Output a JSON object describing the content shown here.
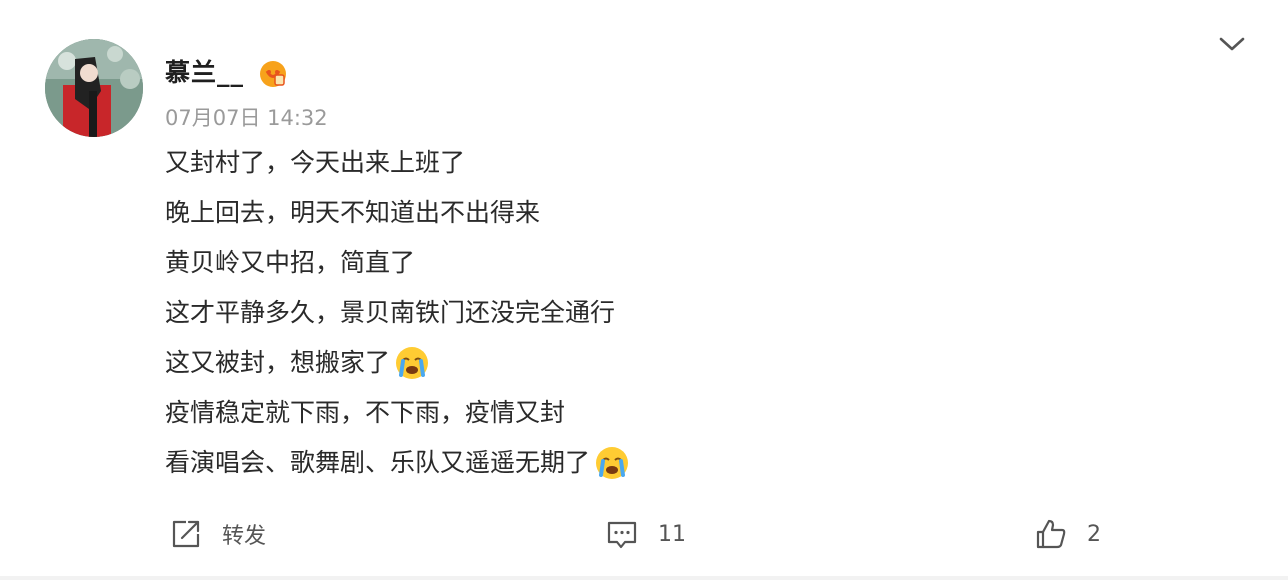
{
  "post": {
    "username": "慕兰__",
    "timestamp": "07月07日 14:32",
    "lines": [
      "又封村了，今天出来上班了",
      "晚上回去，明天不知道出不出得来",
      "黄贝岭又中招，简直了",
      "这才平静多久，景贝南铁门还没完全通行",
      "这又被封，想搬家了",
      "疫情稳定就下雨，不下雨，疫情又封",
      "看演唱会、歌舞剧、乐队又遥遥无期了"
    ],
    "emoji_lines": [
      4,
      6
    ],
    "emoji_name": "crying-face-emoji"
  },
  "actions": {
    "repost_label": "转发",
    "comment_count": "11",
    "like_count": "2"
  },
  "icons": {
    "menu": "chevron-down-icon",
    "badge": "membership-crown-icon",
    "repost": "repost-icon",
    "comment": "comment-icon",
    "like": "thumbs-up-icon"
  },
  "colors": {
    "text": "#2a2a2a",
    "muted": "#9a9a9a",
    "badge": "#f7a21b"
  }
}
